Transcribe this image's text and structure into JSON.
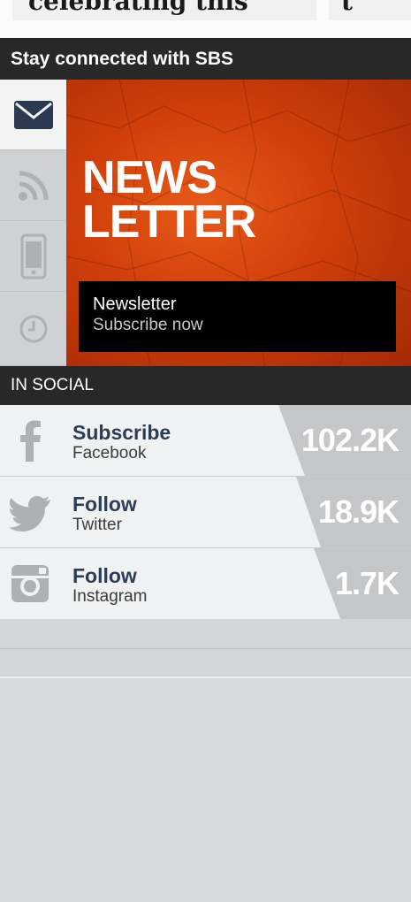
{
  "top": {
    "fragment_left": "celebrating this",
    "fragment_right": "t"
  },
  "stay_connected": {
    "heading": "Stay connected with SBS",
    "tabs": [
      {
        "name": "email",
        "icon": "envelope-icon",
        "active": true
      },
      {
        "name": "rss",
        "icon": "rss-icon",
        "active": false
      },
      {
        "name": "mobile",
        "icon": "mobile-phone-icon",
        "active": false
      },
      {
        "name": "history",
        "icon": "clock-icon",
        "active": false
      }
    ],
    "panel": {
      "title_line1": "NEWS",
      "title_line2": "LETTER",
      "box_title": "Newsletter",
      "box_subtitle": "Subscribe now"
    }
  },
  "in_social": {
    "heading": "IN SOCIAL",
    "items": [
      {
        "action": "Subscribe",
        "network": "Facebook",
        "count": "102.2K",
        "icon": "facebook-icon"
      },
      {
        "action": "Follow",
        "network": "Twitter",
        "count": "18.9K",
        "icon": "twitter-icon"
      },
      {
        "action": "Follow",
        "network": "Instagram",
        "count": "1.7K",
        "icon": "instagram-icon"
      }
    ]
  },
  "colors": {
    "dark_bar": "#282828",
    "hero_orange": "#d8430c",
    "accent_navy": "#2d3d55",
    "count_bg": "#c4c6c8"
  }
}
